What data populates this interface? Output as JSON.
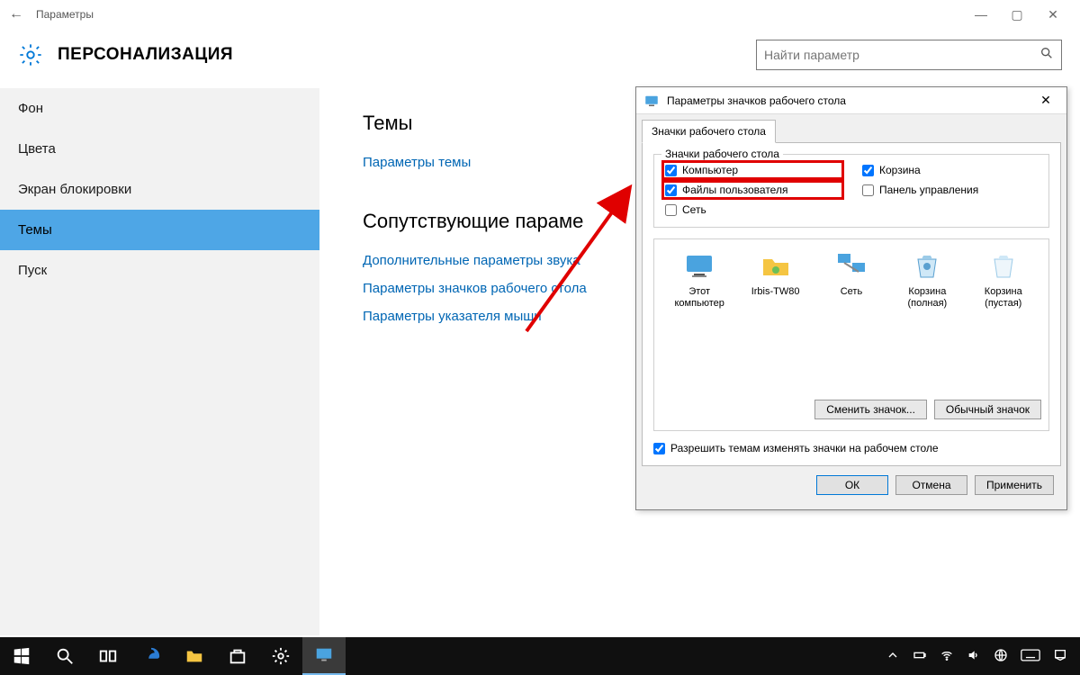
{
  "window": {
    "title": "Параметры",
    "header": "ПЕРСОНАЛИЗАЦИЯ",
    "search_placeholder": "Найти параметр"
  },
  "sidebar": {
    "items": [
      {
        "label": "Фон"
      },
      {
        "label": "Цвета"
      },
      {
        "label": "Экран блокировки"
      },
      {
        "label": "Темы",
        "selected": true
      },
      {
        "label": "Пуск"
      }
    ]
  },
  "content": {
    "section1_title": "Темы",
    "link_theme_settings": "Параметры темы",
    "section2_title": "Сопутствующие параме",
    "link_sound": "Дополнительные параметры звука",
    "link_desktop_icons": "Параметры значков рабочего стола",
    "link_pointer": "Параметры указателя мыши"
  },
  "dialog": {
    "title": "Параметры значков рабочего стола",
    "tab_label": "Значки рабочего стола",
    "group_label": "Значки рабочего стола",
    "checkboxes": {
      "computer": {
        "label": "Компьютер",
        "checked": true
      },
      "recycle": {
        "label": "Корзина",
        "checked": true
      },
      "user_files": {
        "label": "Файлы пользователя",
        "checked": true
      },
      "control_panel": {
        "label": "Панель управления",
        "checked": false
      },
      "network": {
        "label": "Сеть",
        "checked": false
      }
    },
    "icons": [
      {
        "name": "Этот компьютер"
      },
      {
        "name": "Irbis-TW80"
      },
      {
        "name": "Сеть"
      },
      {
        "name": "Корзина (полная)"
      },
      {
        "name": "Корзина (пустая)"
      }
    ],
    "btn_change_icon": "Сменить значок...",
    "btn_default_icon": "Обычный значок",
    "allow_themes": {
      "label": "Разрешить темам изменять значки на рабочем столе",
      "checked": true
    },
    "btn_ok": "ОК",
    "btn_cancel": "Отмена",
    "btn_apply": "Применить"
  }
}
